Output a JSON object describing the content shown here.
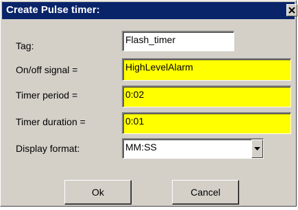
{
  "window": {
    "title": "Create Pulse timer:",
    "close_icon": "close-icon"
  },
  "form": {
    "tag": {
      "label": "Tag:",
      "value": "Flash_timer"
    },
    "signal": {
      "label": "On/off signal =",
      "value": "HighLevelAlarm"
    },
    "period": {
      "label": "Timer period =",
      "value": "0:02"
    },
    "duration": {
      "label": "Timer duration =",
      "value": "0:01"
    },
    "format": {
      "label": "Display format:",
      "value": "MM:SS"
    }
  },
  "buttons": {
    "ok": "Ok",
    "cancel": "Cancel"
  },
  "colors": {
    "title_bar": "#0a246a",
    "dialog_bg": "#d4d0c8",
    "highlight_field": "#ffff00",
    "plain_field": "#ffffff"
  }
}
